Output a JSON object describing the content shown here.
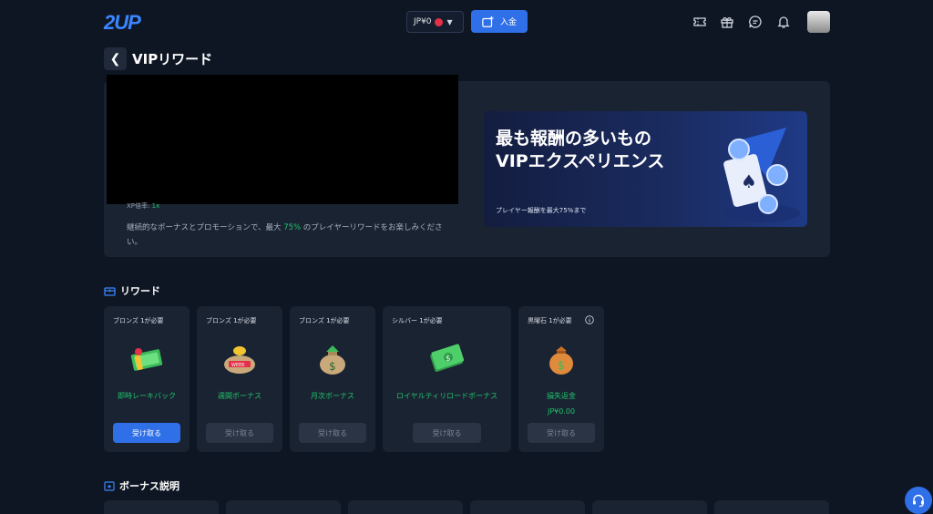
{
  "header": {
    "logo": "2UP",
    "wallet": {
      "balance": "JP¥0"
    },
    "deposit_label": "入金",
    "icons": [
      "ticket-icon",
      "gift-icon",
      "chat-icon",
      "bell-icon"
    ]
  },
  "page": {
    "title": "VIPリワード"
  },
  "vip": {
    "xp_label": "XP倍率",
    "xp_value": "1x",
    "desc_pre": "継続的なボーナスとプロモーションで、最大 ",
    "desc_percent": "75%",
    "desc_post": " のプレイヤーリワードをお楽しみください。"
  },
  "banner": {
    "line1": "最も報酬の多いもの",
    "line2": "VIPエクスペリエンス",
    "subtitle": "プレイヤー報酬を最大75%まで"
  },
  "rewards": {
    "title": "リワード",
    "cards": [
      {
        "requirement": "ブロンズ 1が必要",
        "name": "即時レーキバック",
        "claim_label": "受け取る",
        "icon": "cash-gift-icon"
      },
      {
        "requirement": "ブロンズ 1が必要",
        "name": "週間ボーナス",
        "claim_label": "受け取る",
        "icon": "weekly-bag-icon"
      },
      {
        "requirement": "ブロンズ 1が必要",
        "name": "月次ボーナス",
        "claim_label": "受け取る",
        "icon": "money-sack-icon"
      },
      {
        "requirement": "シルバー 1が必要",
        "name": "ロイヤルティリロードボーナス",
        "claim_label": "受け取る",
        "icon": "cash-stack-icon"
      },
      {
        "requirement": "黒曜石 1が必要",
        "name": "損失返金",
        "amount": "JP¥0.00",
        "claim_label": "受け取る",
        "icon": "coin-bag-icon"
      }
    ]
  },
  "bonus": {
    "title": "ボーナス説明"
  },
  "colors": {
    "background": "#0f1623",
    "panel": "#1a2332",
    "accent": "#2f6fe8",
    "green": "#20c36b"
  }
}
